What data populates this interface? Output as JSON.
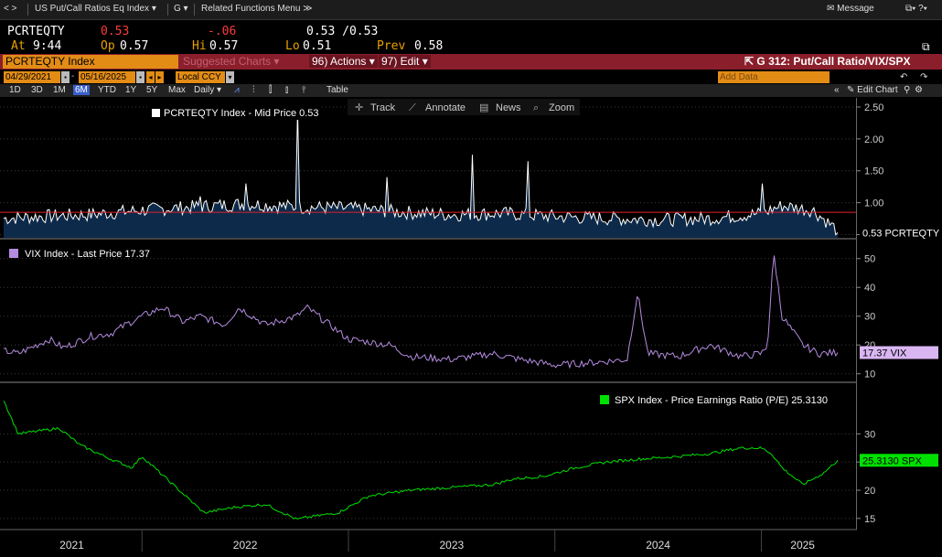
{
  "window": {
    "title": "US Put/Call Ratios Eq Index",
    "g_menu": "G",
    "related": "Related Functions Menu",
    "message": "Message"
  },
  "quote": {
    "ticker": "PCRTEQTY",
    "last": "0.53",
    "change": "-.06",
    "bid_ask": "0.53 /0.53",
    "at_label": "At",
    "time": "9:44",
    "op_label": "Op",
    "open": "0.57",
    "hi_label": "Hi",
    "high": "0.57",
    "lo_label": "Lo",
    "low": "0.51",
    "prev_label": "Prev",
    "prev": "0.58"
  },
  "function_bar": {
    "security": "PCRTEQTY Index",
    "suggested": "Suggested Charts",
    "actions": "96) Actions ▾",
    "edit": "97) Edit ▾",
    "chart_title": "G 312: Put/Call Ratio/VIX/SPX"
  },
  "date_bar": {
    "start": "04/29/2021",
    "end": "05/16/2025",
    "currency": "Local CCY",
    "add_data": "Add Data",
    "edit_chart": "Edit Chart"
  },
  "range_bar": {
    "ranges": [
      "1D",
      "3D",
      "1M",
      "6M",
      "YTD",
      "1Y",
      "5Y",
      "Max"
    ],
    "selected": "6M",
    "frequency": "Daily ▾",
    "table": "Table"
  },
  "toolbar": {
    "track": "Track",
    "annotate": "Annotate",
    "news": "News",
    "zoom": "Zoom"
  },
  "colors": {
    "pcr_line": "#ffffff",
    "pcr_fill": "#0d2a4a",
    "pcr_ref": "#e0202a",
    "vix_line": "#b58ce0",
    "spx_line": "#00e000",
    "accent": "#e28c16"
  },
  "chart_data": [
    {
      "type": "area",
      "legend": "PCRTEQTY Index - Mid Price 0.53",
      "last_label": "0.53 PCRTEQTY",
      "ylim": [
        0.45,
        2.6
      ],
      "yticks": [
        "2.50",
        "2.00",
        "1.50",
        "1.00",
        "0.50"
      ],
      "reference_line": 0.85,
      "x": [
        2021.33,
        2021.5,
        2021.75,
        2022.0,
        2022.25,
        2022.5,
        2022.75,
        2023.0,
        2023.25,
        2023.5,
        2023.75,
        2024.0,
        2024.25,
        2024.5,
        2024.75,
        2025.0,
        2025.1,
        2025.25,
        2025.37
      ],
      "y": [
        0.72,
        0.75,
        0.78,
        0.85,
        0.9,
        0.95,
        0.9,
        0.88,
        0.82,
        0.78,
        0.8,
        0.75,
        0.72,
        0.7,
        0.72,
        0.8,
        0.92,
        0.85,
        0.53
      ],
      "spikes": [
        {
          "x": 2022.28,
          "y": 1.1
        },
        {
          "x": 2022.5,
          "y": 1.3
        },
        {
          "x": 2022.75,
          "y": 2.45
        },
        {
          "x": 2023.19,
          "y": 1.4
        },
        {
          "x": 2023.6,
          "y": 1.75
        },
        {
          "x": 2023.87,
          "y": 1.65
        },
        {
          "x": 2025.0,
          "y": 1.3
        }
      ]
    },
    {
      "type": "line",
      "legend": "VIX Index - Last Price 17.37",
      "last_label": "17.37 VIX",
      "ylim": [
        8,
        55
      ],
      "yticks": [
        "50",
        "40",
        "30",
        "20",
        "10"
      ],
      "x": [
        2021.33,
        2021.4,
        2021.55,
        2021.62,
        2021.75,
        2021.85,
        2021.92,
        2022.0,
        2022.1,
        2022.2,
        2022.28,
        2022.4,
        2022.47,
        2022.6,
        2022.75,
        2022.8,
        2023.0,
        2023.2,
        2023.3,
        2023.5,
        2023.7,
        2023.83,
        2024.0,
        2024.2,
        2024.35,
        2024.4,
        2024.45,
        2024.6,
        2024.75,
        2024.9,
        2025.0,
        2025.03,
        2025.06,
        2025.1,
        2025.2,
        2025.28,
        2025.37
      ],
      "y": [
        18,
        17,
        22,
        19,
        23,
        24,
        27,
        30,
        33,
        28,
        30,
        27,
        33,
        27,
        30,
        33,
        22,
        20,
        16,
        15,
        17,
        15,
        13,
        14,
        15,
        38,
        17,
        16,
        20,
        16,
        17,
        20,
        52,
        30,
        20,
        17,
        17.37
      ]
    },
    {
      "type": "line",
      "legend": "SPX Index - Price Earnings Ratio (P/E) 25.3130",
      "last_label": "25.3130 SPX",
      "ylim": [
        14,
        38
      ],
      "yticks": [
        "30",
        "25",
        "20",
        "15"
      ],
      "x": [
        2021.33,
        2021.4,
        2021.6,
        2021.7,
        2021.85,
        2021.95,
        2022.0,
        2022.15,
        2022.3,
        2022.45,
        2022.6,
        2022.75,
        2022.8,
        2022.95,
        2023.1,
        2023.3,
        2023.5,
        2023.7,
        2023.8,
        2023.95,
        2024.1,
        2024.25,
        2024.4,
        2024.6,
        2024.75,
        2024.9,
        2025.0,
        2025.05,
        2025.1,
        2025.2,
        2025.3,
        2025.37
      ],
      "y": [
        36,
        30,
        31,
        28,
        25.5,
        24,
        26,
        21,
        16,
        17,
        17.5,
        14.8,
        15.2,
        16,
        19,
        20,
        20.5,
        21,
        22,
        22.5,
        24,
        25,
        25.5,
        26,
        26.5,
        27.5,
        27.5,
        26.5,
        24,
        21,
        23,
        25.31
      ]
    }
  ],
  "x_axis": {
    "years": [
      "2021",
      "2022",
      "2023",
      "2024",
      "2025"
    ]
  }
}
